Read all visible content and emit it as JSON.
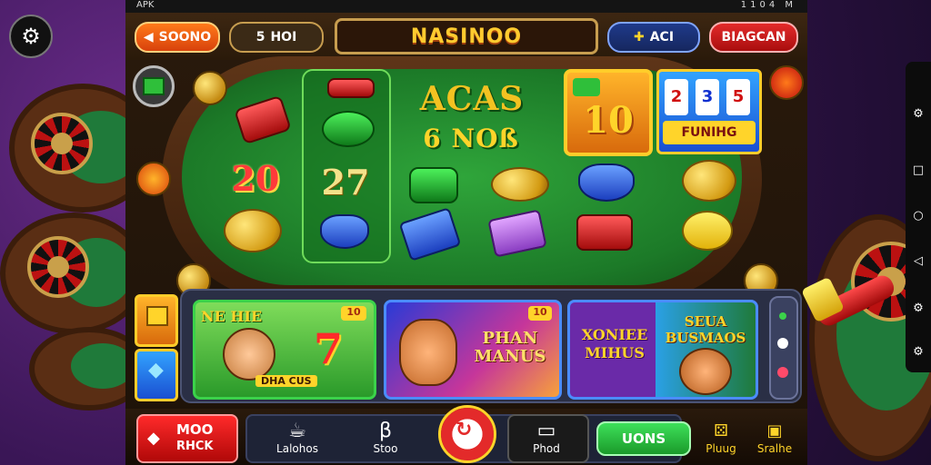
{
  "status_bar": {
    "left": "APK",
    "right": "1104 M"
  },
  "top_bar": {
    "left_button": "SOONO",
    "second_button": "HOI",
    "title": "NASINOO",
    "balance": "ACI",
    "right_button": "BIAGCAN"
  },
  "table": {
    "logo_line1": "ACAS",
    "logo_line2": "6 NOß",
    "left_number": "20",
    "center_number": "10",
    "mini_slot_label": "FUNIHG",
    "mini_slot_symbols": [
      "2",
      "3",
      "5"
    ],
    "reel_symbol_27": "27"
  },
  "games": [
    {
      "title": "NE HIE",
      "badge": "10",
      "number": "7",
      "footer": "DHA CUS",
      "color": "#2aa83a"
    },
    {
      "title": "PHAN MANUS",
      "badge": "10",
      "color": "#3b4ad6"
    },
    {
      "title": "XONIEE MIHUS",
      "subtitle": "SEUA BUSMAOS",
      "color": "#6a2aa8"
    }
  ],
  "side_panel": {
    "top_label": "",
    "bottom_label": ""
  },
  "bottom_nav": {
    "promo_line1": "MOO",
    "promo_line2": "RHCK",
    "items": [
      {
        "label": "Lalohos",
        "icon": "cup-icon"
      },
      {
        "label": "Stoo",
        "icon": "b8-icon"
      },
      {
        "label": "Phod",
        "icon": "folder-icon"
      }
    ],
    "green_button": "UONS",
    "right_items": [
      {
        "label": "Pluug"
      },
      {
        "label": "Sralhe"
      }
    ]
  }
}
